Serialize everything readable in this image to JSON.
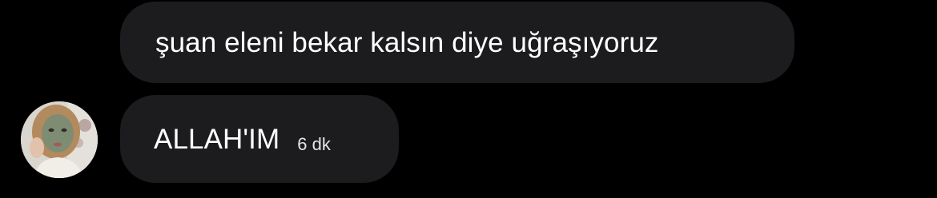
{
  "messages": [
    {
      "text": "şuan eleni bekar kalsın diye uğraşıyoruz",
      "sender": "other"
    },
    {
      "text": "ALLAH'IM",
      "timestamp": "6 dk",
      "sender": "other"
    }
  ],
  "avatar": {
    "icon": "user-avatar-photo"
  },
  "colors": {
    "background": "#000000",
    "bubble": "#1c1c1e",
    "text": "#ffffff"
  }
}
